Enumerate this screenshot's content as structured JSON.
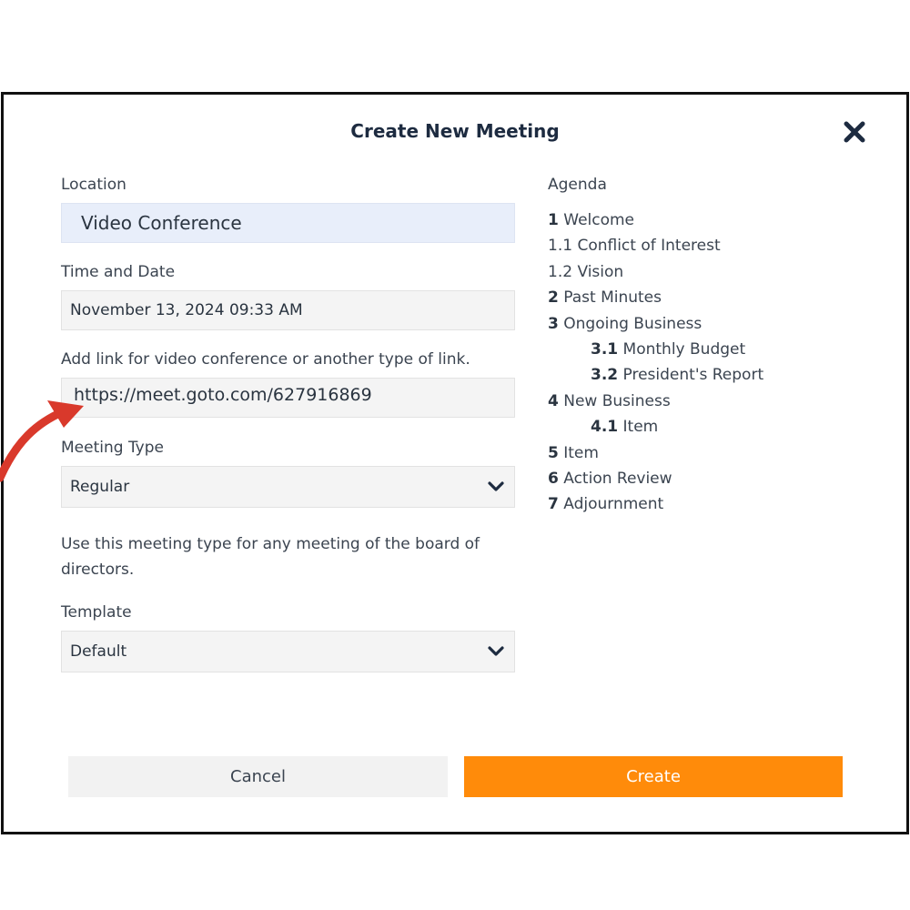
{
  "dialog": {
    "title": "Create New Meeting",
    "close_icon": "close-x-icon"
  },
  "form": {
    "location_label": "Location",
    "location_value": "Video Conference",
    "datetime_label": "Time and Date",
    "datetime_value": "November 13, 2024 09:33 AM",
    "link_label": "Add link for video conference or another type of link.",
    "link_value": "https://meet.goto.com/627916869",
    "meeting_type_label": "Meeting Type",
    "meeting_type_value": "Regular",
    "meeting_type_help": "Use this meeting type for any meeting of the board of directors.",
    "template_label": "Template",
    "template_value": "Default"
  },
  "agenda": {
    "title": "Agenda",
    "items": [
      {
        "num": "1",
        "text": "Welcome",
        "bold": true,
        "indent": false
      },
      {
        "num": "1.1",
        "text": "Conflict of Interest",
        "bold": false,
        "indent": false
      },
      {
        "num": "1.2",
        "text": "Vision",
        "bold": false,
        "indent": false
      },
      {
        "num": "2",
        "text": "Past Minutes",
        "bold": true,
        "indent": false
      },
      {
        "num": "3",
        "text": "Ongoing Business",
        "bold": true,
        "indent": false
      },
      {
        "num": "3.1",
        "text": "Monthly Budget",
        "bold": true,
        "indent": true
      },
      {
        "num": "3.2",
        "text": "President's Report",
        "bold": true,
        "indent": true
      },
      {
        "num": "4",
        "text": "New Business",
        "bold": true,
        "indent": false
      },
      {
        "num": "4.1",
        "text": "Item",
        "bold": true,
        "indent": true
      },
      {
        "num": "5",
        "text": "Item",
        "bold": true,
        "indent": false
      },
      {
        "num": "6",
        "text": "Action Review",
        "bold": true,
        "indent": false
      },
      {
        "num": "7",
        "text": "Adjournment",
        "bold": true,
        "indent": false
      }
    ]
  },
  "buttons": {
    "cancel_label": "Cancel",
    "create_label": "Create"
  },
  "colors": {
    "accent": "#ff8b0a",
    "location_field_bg": "#e8eefa",
    "annotation_arrow": "#d9392b"
  },
  "icons": {
    "dropdown": "chevron-down-icon",
    "annotation": "curved-arrow-icon"
  }
}
